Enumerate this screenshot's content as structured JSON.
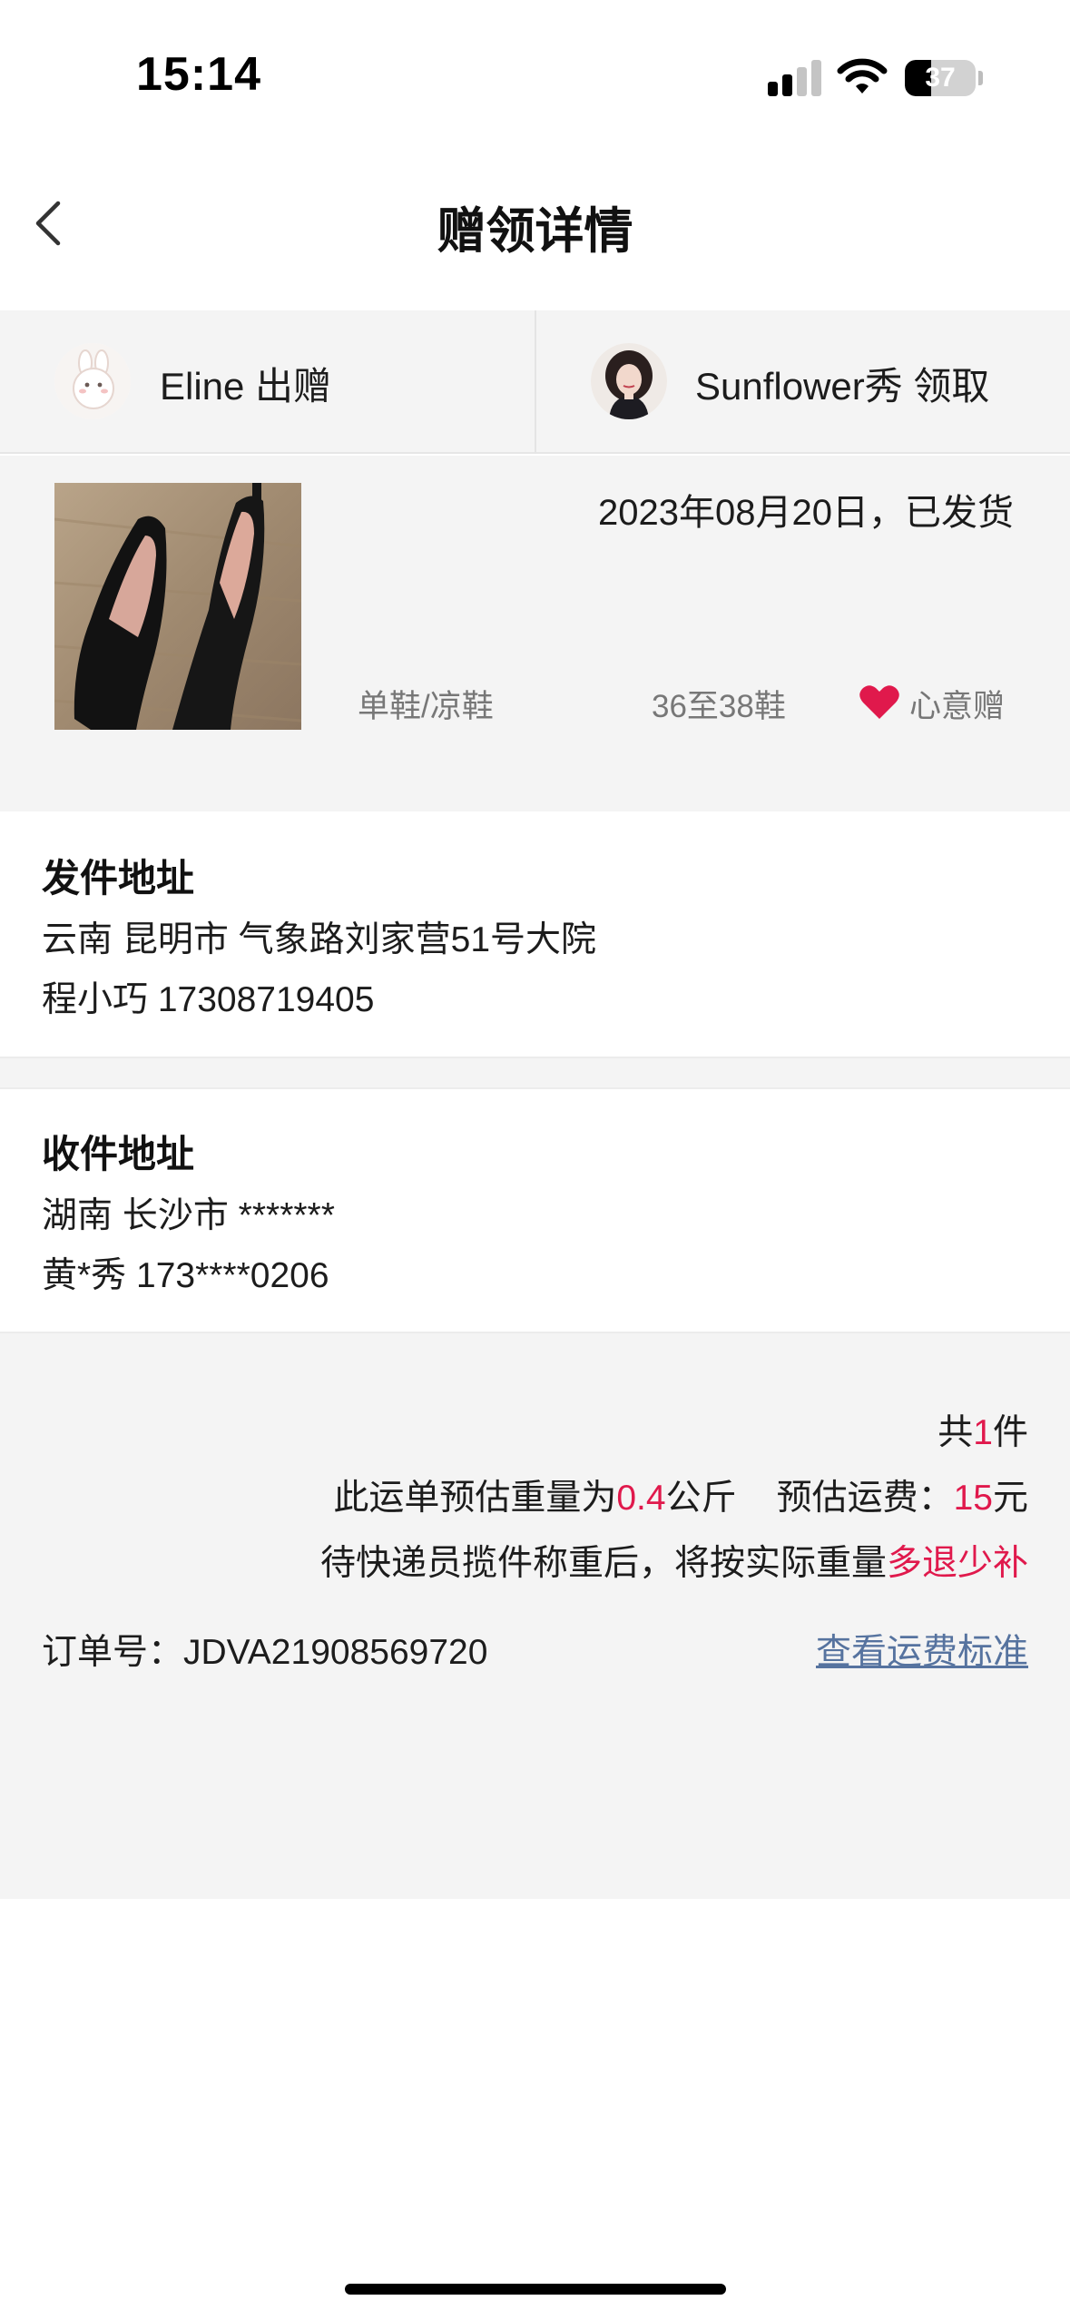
{
  "status_bar": {
    "time": "15:14",
    "battery": "37",
    "battery_level": 0.37
  },
  "nav": {
    "title": "赠领详情",
    "back_icon": "chevron-left-icon"
  },
  "participants": {
    "giver": {
      "name": "Eline",
      "action": "出赠",
      "label": "Eline 出赠"
    },
    "receiver": {
      "name": "Sunflower秀",
      "action": "领取",
      "label": "Sunflower秀 领取"
    }
  },
  "item": {
    "status": "2023年08月20日，已发货",
    "category": "单鞋/凉鞋",
    "size": "36至38鞋",
    "gift_type": "心意赠",
    "gift_icon": "heart-icon",
    "accent_color": "#e0194c"
  },
  "sender_address": {
    "title": "发件地址",
    "address": "云南 昆明市 气象路刘家营51号大院",
    "contact": "程小巧 17308719405"
  },
  "receiver_address": {
    "title": "收件地址",
    "address": "湖南 长沙市 *******",
    "contact": "黄*秀 173****0206"
  },
  "summary": {
    "count_prefix": "共",
    "count": "1",
    "count_suffix": "件",
    "weight_prefix": "此运单预估重量为",
    "weight": "0.4",
    "weight_suffix": "公斤",
    "fee_prefix": "预估运费：",
    "fee": "15",
    "fee_suffix": "元",
    "note_prefix": "待快递员揽件称重后，将按实际重量",
    "note_highlight": "多退少补",
    "order_label": "订单号：",
    "order_number": "JDVA21908569720",
    "fee_link": "查看运费标准",
    "link_color": "#56739f"
  }
}
